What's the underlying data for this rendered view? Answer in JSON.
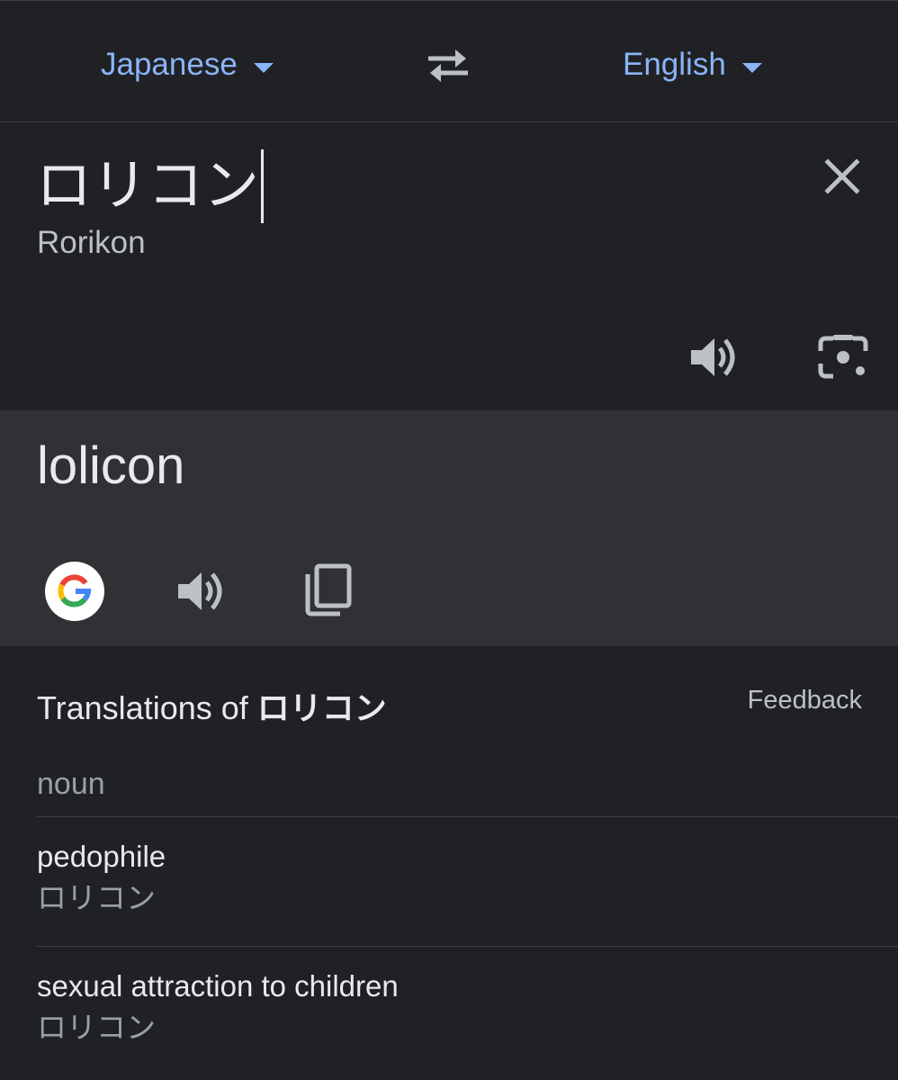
{
  "languages": {
    "source": "Japanese",
    "target": "English"
  },
  "source": {
    "text": "ロリコン",
    "romanization": "Rorikon"
  },
  "translation": {
    "text": "lolicon"
  },
  "dictionary": {
    "title_prefix": "Translations of ",
    "title_term": "ロリコン",
    "feedback_label": "Feedback",
    "part_of_speech": "noun",
    "entries": [
      {
        "word": "pedophile",
        "back_translation": "ロリコン"
      },
      {
        "word": "sexual attraction to children",
        "back_translation": "ロリコン"
      }
    ]
  },
  "colors": {
    "accent": "#8ab4f8",
    "background": "#202124",
    "result_background": "#303134",
    "icon": "#bdc1c6"
  },
  "icons": [
    "chevron-down-icon",
    "swap-icon",
    "close-icon",
    "speaker-icon",
    "camera-icon",
    "google-icon",
    "copy-icon"
  ]
}
